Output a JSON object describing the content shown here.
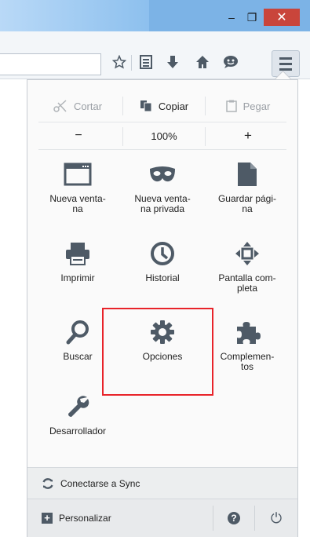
{
  "window": {
    "minimize_glyph": "–",
    "maximize_glyph": "❐",
    "close_glyph": "✕"
  },
  "toolbar": {
    "icons": [
      "bookmark-star-icon",
      "bookmarks-list-icon",
      "downloads-icon",
      "home-icon",
      "hello-chat-icon",
      "menu-icon"
    ]
  },
  "panel": {
    "edit": {
      "cut": "Cortar",
      "copy": "Copiar",
      "paste": "Pegar"
    },
    "zoom": {
      "minus": "−",
      "level": "100%",
      "plus": "+"
    },
    "items": [
      {
        "label": "Nueva venta-\nna",
        "icon": "new-window-icon"
      },
      {
        "label": "Nueva venta-\nna privada",
        "icon": "private-mask-icon"
      },
      {
        "label": "Guardar pági-\nna",
        "icon": "save-page-icon"
      },
      {
        "label": "Imprimir",
        "icon": "printer-icon"
      },
      {
        "label": "Historial",
        "icon": "clock-icon"
      },
      {
        "label": "Pantalla com-\npleta",
        "icon": "fullscreen-icon"
      },
      {
        "label": "Buscar",
        "icon": "magnifier-icon"
      },
      {
        "label": "Opciones",
        "icon": "gear-icon"
      },
      {
        "label": "Complemen-\ntos",
        "icon": "puzzle-icon"
      },
      {
        "label": "Desarrollador",
        "icon": "wrench-icon"
      }
    ],
    "sync_label": "Conectarse a Sync",
    "customize_label": "Personalizar",
    "help_glyph": "?",
    "quit_glyph": "⏻"
  },
  "colors": {
    "highlight": "#e8232a",
    "titlebar": "#7cb3e6",
    "close": "#c9453b"
  }
}
